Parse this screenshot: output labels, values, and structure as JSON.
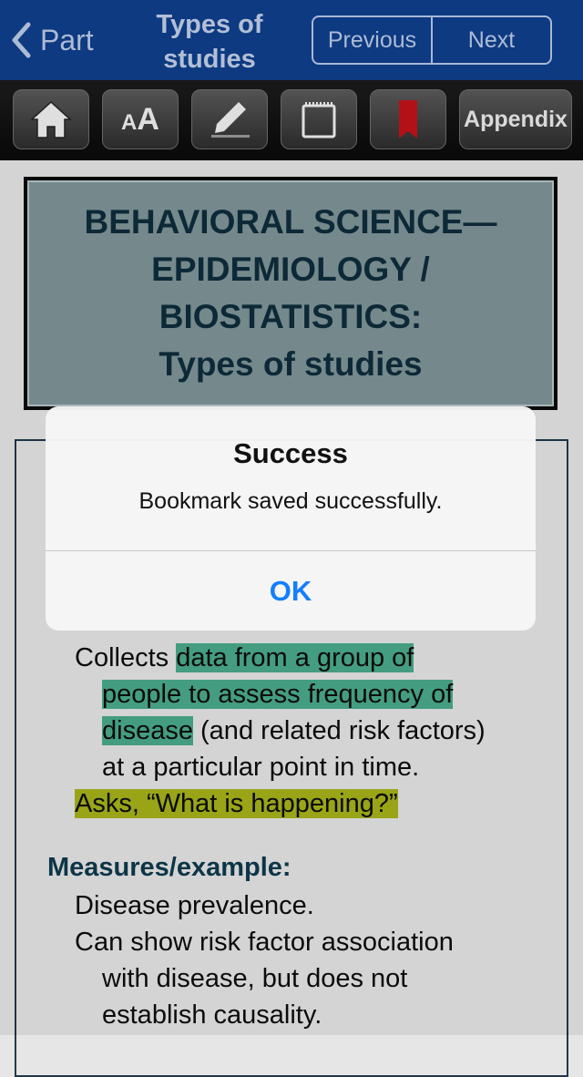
{
  "navbar": {
    "back_label": "Part",
    "title": "Types of\nstudies",
    "previous_label": "Previous",
    "next_label": "Next"
  },
  "toolbar": {
    "appendix_label": "Appendix",
    "font_size_label_small": "A",
    "font_size_label_big": "A"
  },
  "content": {
    "header_title": "BEHAVIORAL SCIENCE—\nEPIDEMIOLOGY /\nBIOSTATISTICS:\nTypes of studies",
    "paragraph": {
      "l1_plain": "Collects ",
      "l1_hl": "data from a group of",
      "l2_hl": "people to assess frequency of",
      "l3_hl": "disease",
      "l3_plain": " (and related risk factors)",
      "l4": "at a particular point in time.",
      "l5_hl": "Asks, “What is happening?”"
    },
    "measures_heading": "Measures/example:",
    "measures_lines": [
      "Disease prevalence.",
      "Can show risk factor association",
      "with disease, but does not",
      "establish causality."
    ]
  },
  "alert": {
    "title": "Success",
    "message": "Bookmark saved successfully.",
    "ok_label": "OK"
  },
  "colors": {
    "navbar_bg": "#0f3f8c",
    "header_box_bg": "#7f9598",
    "highlight_green": "#4aab8b",
    "highlight_yellow": "#a6b31a",
    "alert_button": "#147efb"
  }
}
